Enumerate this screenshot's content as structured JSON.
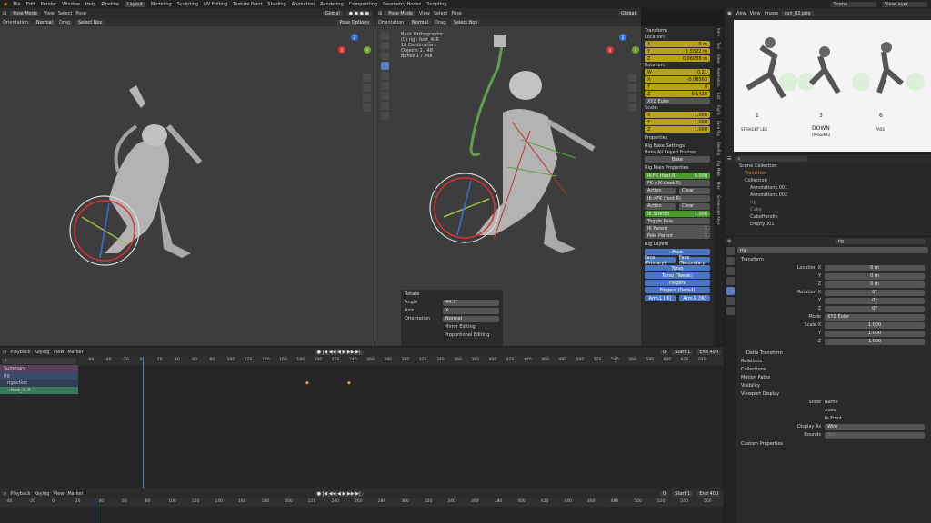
{
  "menu": {
    "items": [
      "File",
      "Edit",
      "Render",
      "Window",
      "Help",
      "Pipeline"
    ],
    "tabs": [
      "Layout",
      "Modeling",
      "Sculpting",
      "UV Editing",
      "Texture Paint",
      "Shading",
      "Animation",
      "Rendering",
      "Compositing",
      "Geometry Nodes",
      "Scripting"
    ],
    "active_tab": "Layout",
    "scene": "Scene",
    "viewlayer": "ViewLayer"
  },
  "vp_left": {
    "mode": "Pose Mode",
    "menus": [
      "View",
      "Select",
      "Pose"
    ],
    "transform": "Global",
    "orientation_label": "Orientation:",
    "orientation": "Normal",
    "drag_label": "Drag:",
    "drag": "Select Box",
    "pose_options": "Pose Options"
  },
  "vp_right": {
    "mode": "Pose Mode",
    "menus": [
      "View",
      "Select",
      "Pose"
    ],
    "transform": "Global",
    "orientation_label": "Orientation:",
    "orientation": "Normal",
    "drag_label": "Drag:",
    "drag": "Select Box",
    "pose_options": "Pose Options",
    "overlay_lines": [
      "Back Orthographic",
      "(0) rig : foot_ik.R",
      "10 Centimeters",
      "",
      "Objects     1 / 48",
      "Bones       1 / 348"
    ]
  },
  "redo": {
    "title": "Rotate",
    "angle_label": "Angle",
    "angle": "44.3°",
    "axis_label": "Axis",
    "axis": "X",
    "orientation_label": "Orientation",
    "orientation": "Normal",
    "mirror": "Mirror Editing",
    "proportional": "Proportional Editing"
  },
  "npanel": {
    "transform_title": "Transform",
    "location_label": "Location:",
    "loc": [
      {
        "a": "X",
        "v": "0 m"
      },
      {
        "a": "Y",
        "v": "1.5522 m"
      },
      {
        "a": "Z",
        "v": "0.06038 m"
      }
    ],
    "rotation_label": "Rotation:",
    "rot": [
      {
        "a": "W",
        "v": "0.21"
      },
      {
        "a": "X",
        "v": "-0.08563"
      },
      {
        "a": "Y",
        "v": "0"
      },
      {
        "a": "Z",
        "v": "0.1420"
      }
    ],
    "rot_mode": "XYZ Euler",
    "scale_label": "Scale:",
    "scl": [
      {
        "a": "X",
        "v": "1.000"
      },
      {
        "a": "Y",
        "v": "1.000"
      },
      {
        "a": "Z",
        "v": "1.000"
      }
    ],
    "properties": "Properties",
    "bake_title": "Rig Bake Settings",
    "bake_all": "Bake All Keyed Frames",
    "bake_btn": "Bake",
    "main_title": "Rig Main Properties",
    "ikfk": "IK-FK (foot.R)",
    "ikfk_val": "0.000",
    "fk_ik": "FK->IK (foot.R)",
    "action": "Action",
    "clear": "Clear",
    "ik_fk": "IK->FK (foot.R)",
    "ik_stretch": "IK Stretch",
    "ik_stretch_val": "1.000",
    "toggle_pole": "Toggle Pole",
    "ik_parent": "IK Parent",
    "ik_parent_val": "1",
    "pole_parent": "Pole Parent",
    "pole_parent_val": "1",
    "layers_title": "Rig Layers",
    "layers": [
      [
        "Face"
      ],
      [
        "Face (Primary)",
        "Face (Secondary)"
      ],
      [
        "Torso"
      ],
      [
        "Torso (Tweak)"
      ],
      [
        "Fingers"
      ],
      [
        "Fingers (Detail)"
      ],
      [
        "Arm.L (IK)",
        "Arm.R (IK)"
      ]
    ],
    "vtabs": [
      "Item",
      "Tool",
      "View",
      "Animation",
      "Edit",
      "Rigify",
      "Face Rig",
      "BlenRig",
      "Rig Main",
      "Misc",
      "Screencast Keys",
      "Create"
    ]
  },
  "image_editor": {
    "menus": [
      "View",
      "View",
      "Image"
    ],
    "image": "run_02.png",
    "labels": [
      "1",
      "3",
      "6"
    ],
    "sublabels": [
      "STRAIGHT LEG",
      "DOWN",
      "PASS"
    ],
    "subsub": "(PASSING)"
  },
  "outliner": {
    "items": [
      "Scene Collection",
      "Transition",
      "Collection",
      "Annotations.001",
      "Annotations.002",
      "rig",
      "Cube",
      "CubeHandle",
      "Empty.001",
      "Plane.003"
    ]
  },
  "props": {
    "search": "rig",
    "tab": "rig",
    "transform": "Transform",
    "locx_label": "Location X",
    "locx": "0 m",
    "locy_label": "Y",
    "locy": "0 m",
    "locz_label": "Z",
    "locz": "0 m",
    "rotx_label": "Rotation X",
    "rotx": "0°",
    "roty_label": "Y",
    "roty": "0°",
    "rotz_label": "Z",
    "rotz": "0°",
    "mode_label": "Mode",
    "mode": "XYZ Euler",
    "sclx_label": "Scale X",
    "sclx": "1.000",
    "scly_label": "Y",
    "scly": "1.000",
    "sclz_label": "Z",
    "sclz": "1.000",
    "sections": [
      "Delta Transform",
      "Relations",
      "Collections",
      "Motion Paths",
      "Visibility",
      "Viewport Display"
    ],
    "show_label": "Show",
    "name": "Name",
    "axes": "Axes",
    "infront": "In Front",
    "display_as_label": "Display As",
    "display_as": "Wire",
    "bounds_label": "Bounds",
    "bounds": "Box",
    "custom": "Custom Properties"
  },
  "dope": {
    "menus": [
      "Playback",
      "Keying",
      "View",
      "Marker"
    ],
    "frame": "0",
    "start_label": "Start",
    "start": "1",
    "end_label": "End",
    "end": "400",
    "ticks": [
      "-60",
      "-40",
      "-20",
      "0",
      "20",
      "40",
      "60",
      "80",
      "100",
      "120",
      "140",
      "160",
      "180",
      "200",
      "220",
      "240",
      "260",
      "280",
      "300",
      "320",
      "340",
      "360",
      "380",
      "400",
      "420",
      "440",
      "460",
      "480",
      "500",
      "520",
      "540",
      "560",
      "580",
      "600",
      "620",
      "640"
    ],
    "channels": [
      "Summary",
      "rig",
      "rigAction",
      "foot_ik.R"
    ]
  },
  "tl": {
    "menus": [
      "Playback",
      "Keying",
      "View",
      "Marker"
    ],
    "frame": "0",
    "start_label": "Start",
    "start": "1",
    "end_label": "End",
    "end": "400",
    "ticks": [
      "-40",
      "-20",
      "0",
      "20",
      "40",
      "60",
      "80",
      "100",
      "120",
      "140",
      "160",
      "180",
      "200",
      "220",
      "240",
      "260",
      "280",
      "300",
      "320",
      "340",
      "360",
      "380",
      "400",
      "420",
      "440",
      "460",
      "480",
      "500",
      "520",
      "540",
      "560"
    ]
  }
}
